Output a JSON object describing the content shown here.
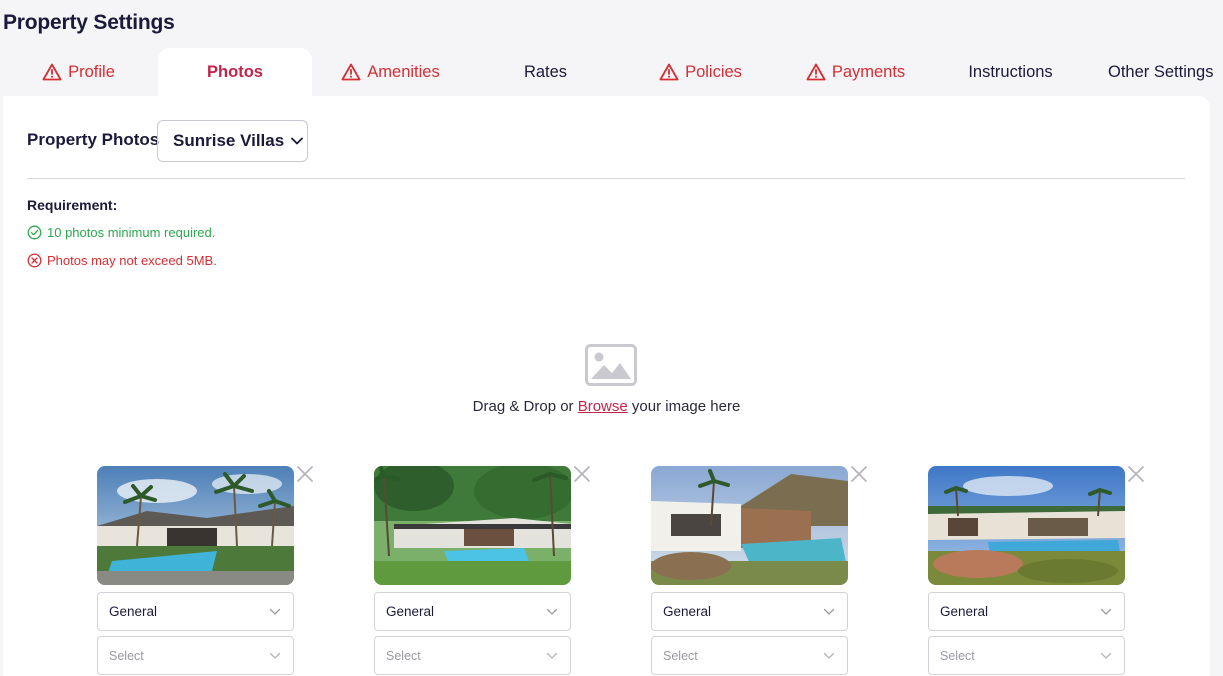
{
  "page": {
    "title": "Property Settings"
  },
  "tabs": [
    {
      "label": "Profile",
      "warning": true
    },
    {
      "label": "Photos",
      "active": true
    },
    {
      "label": "Amenities",
      "warning": true
    },
    {
      "label": "Rates"
    },
    {
      "label": "Policies",
      "warning": true
    },
    {
      "label": "Payments",
      "warning": true
    },
    {
      "label": "Instructions"
    },
    {
      "label": "Other Settings"
    }
  ],
  "photos_section": {
    "label": "Property Photos",
    "selected_property": "Sunrise Villas"
  },
  "requirements": {
    "title": "Requirement:",
    "ok": "10 photos minimum required.",
    "fail": "Photos may not exceed 5MB."
  },
  "dropzone": {
    "prefix": "Drag & Drop or ",
    "link": "Browse",
    "suffix": " your image here"
  },
  "photos": [
    {
      "category": "General",
      "sub_placeholder": "Select"
    },
    {
      "category": "General",
      "sub_placeholder": "Select"
    },
    {
      "category": "General",
      "sub_placeholder": "Select"
    },
    {
      "category": "General",
      "sub_placeholder": "Select"
    }
  ],
  "colors": {
    "brand": "#c0254a",
    "warning": "#d32f35",
    "success": "#2fa84f",
    "text": "#1c1a3a"
  }
}
